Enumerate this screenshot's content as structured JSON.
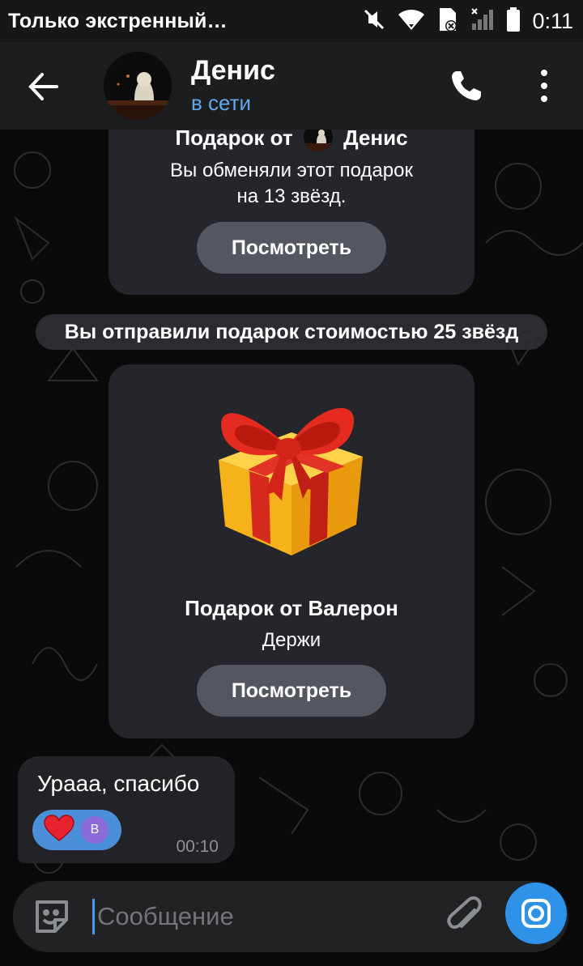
{
  "status_bar": {
    "notification_text": "Только экстренный…",
    "time": "0:11",
    "icons": [
      "mute-icon",
      "wifi-icon",
      "sim-blocked-icon",
      "signal-icon",
      "battery-icon"
    ]
  },
  "header": {
    "name": "Денис",
    "status": "в сети",
    "icons": [
      "back-arrow-icon",
      "phone-icon",
      "more-vertical-icon"
    ]
  },
  "gift_received": {
    "title_prefix": "Подарок от",
    "title_name": "Денис",
    "subtitle_line1": "Вы обменяли этот подарок",
    "subtitle_line2": "на 13 звёзд.",
    "button": "Посмотреть"
  },
  "service_message": "Вы отправили подарок стоимостью 25 звёзд",
  "gift_sent": {
    "title": "Подарок от Валерон",
    "subtitle": "Держи",
    "button": "Посмотреть"
  },
  "message": {
    "text": "Урааа, спасибо",
    "time": "00:10",
    "reaction": "heart",
    "reaction_avatar_letter": "В"
  },
  "composer": {
    "placeholder": "Сообщение",
    "icons": [
      "sticker-icon",
      "paperclip-icon",
      "camera-icon"
    ]
  },
  "colors": {
    "accent": "#62a8ea",
    "send_button": "#2e93e8",
    "reaction_bg": "#4a8fd8"
  }
}
